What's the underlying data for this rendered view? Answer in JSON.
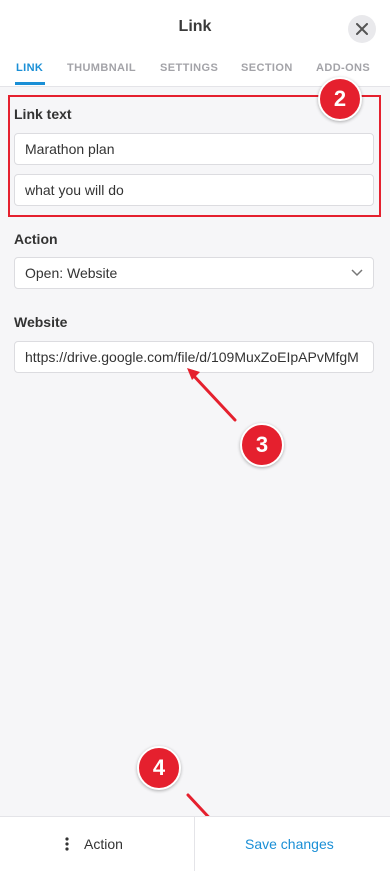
{
  "header": {
    "title": "Link",
    "close_icon": "close-icon",
    "tabs": [
      {
        "label": "LINK",
        "active": true
      },
      {
        "label": "THUMBNAIL",
        "active": false
      },
      {
        "label": "SETTINGS",
        "active": false
      },
      {
        "label": "SECTION",
        "active": false
      },
      {
        "label": "ADD-ONS",
        "active": false
      }
    ]
  },
  "form": {
    "link_text_label": "Link text",
    "link_text_line1": "Marathon plan",
    "link_text_line2": "what you will do",
    "action_label": "Action",
    "action_value": "Open: Website",
    "website_label": "Website",
    "website_value": "https://drive.google.com/file/d/109MuxZoEIpAPvMfgM"
  },
  "annotations": {
    "marker_2": "2",
    "marker_3": "3",
    "marker_4": "4",
    "color": "#e5202e"
  },
  "footer": {
    "action_label": "Action",
    "action_icon": "more-vertical-icon",
    "save_label": "Save changes"
  },
  "colors": {
    "accent": "#1a8fd6",
    "background": "#f6f6f8",
    "annotation_red": "#e5202e"
  }
}
